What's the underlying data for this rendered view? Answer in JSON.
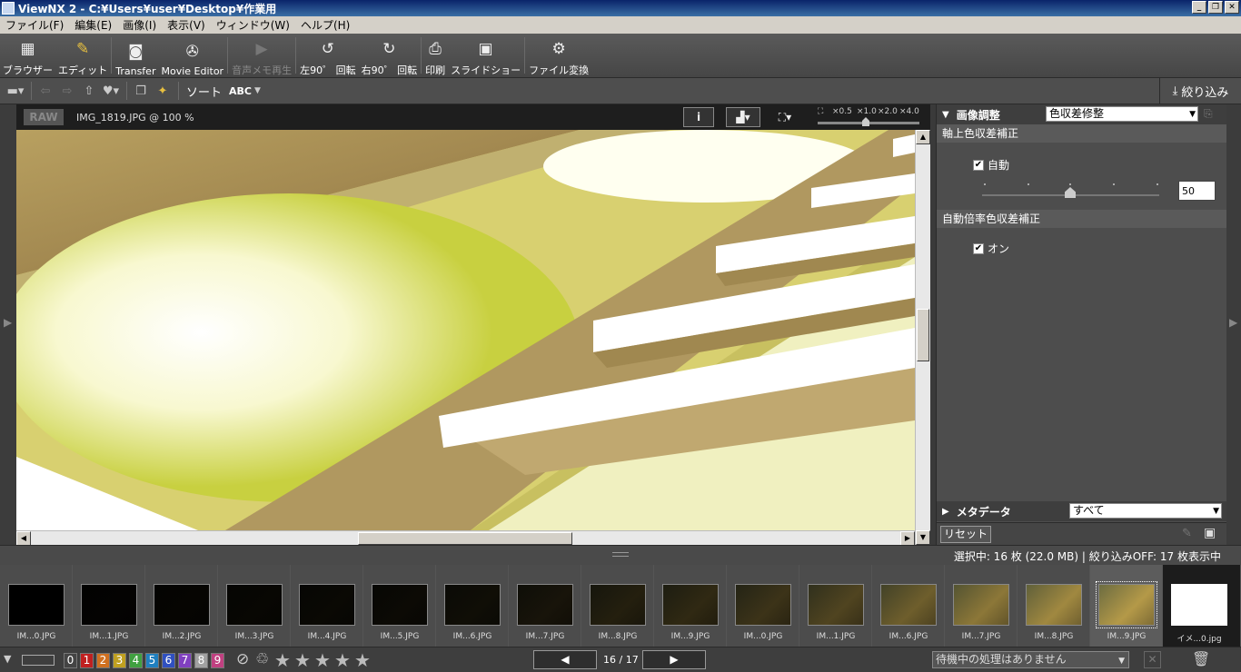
{
  "window": {
    "title": "ViewNX 2 - C:¥Users¥user¥Desktop¥作業用"
  },
  "menu": [
    "ファイル(F)",
    "編集(E)",
    "画像(I)",
    "表示(V)",
    "ウィンドウ(W)",
    "ヘルプ(H)"
  ],
  "toolbar": {
    "browser": "ブラウザー",
    "edit": "エディット",
    "transfer": "Transfer",
    "movie_editor": "Movie Editor",
    "voice_memo": "音声メモ再生",
    "rotate_left": "左90゜ 回転",
    "rotate_right": "右90゜ 回転",
    "print": "印刷",
    "slideshow": "スライドショー",
    "convert": "ファイル変換"
  },
  "toolbar2": {
    "sort_label": "ソート",
    "sort_value": "ABC",
    "filter_label": "絞り込み"
  },
  "viewer": {
    "raw_badge": "RAW",
    "filename": "IMG_1819.JPG @ 100 %",
    "zoom_levels": [
      "×0.5",
      "×1.0",
      "×2.0",
      "×4.0"
    ],
    "zoom_level": 1.0
  },
  "panel": {
    "title": "画像調整",
    "adjust_select": "色収差修整",
    "section1": "軸上色収差補正",
    "auto_label": "自動",
    "auto_checked": true,
    "slider_value": "50",
    "section2": "自動倍率色収差補正",
    "on_label": "オン",
    "on_checked": true,
    "metadata_title": "メタデータ",
    "metadata_select": "すべて",
    "reset": "リセット"
  },
  "status": "選択中: 16 枚 (22.0 MB) | 絞り込みOFF: 17 枚表示中",
  "thumbnails": [
    {
      "name": "IM...0.JPG",
      "bright": 0.0
    },
    {
      "name": "IM...1.JPG",
      "bright": 0.02
    },
    {
      "name": "IM...2.JPG",
      "bright": 0.03
    },
    {
      "name": "IM...3.JPG",
      "bright": 0.04
    },
    {
      "name": "IM...4.JPG",
      "bright": 0.05
    },
    {
      "name": "IM...5.JPG",
      "bright": 0.06
    },
    {
      "name": "IM...6.JPG",
      "bright": 0.08
    },
    {
      "name": "IM...7.JPG",
      "bright": 0.12
    },
    {
      "name": "IM...8.JPG",
      "bright": 0.18
    },
    {
      "name": "IM...9.JPG",
      "bright": 0.24
    },
    {
      "name": "IM...0.JPG",
      "bright": 0.3
    },
    {
      "name": "IM...1.JPG",
      "bright": 0.4
    },
    {
      "name": "IM...6.JPG",
      "bright": 0.55
    },
    {
      "name": "IM...7.JPG",
      "bright": 0.7
    },
    {
      "name": "IM...8.JPG",
      "bright": 0.8
    },
    {
      "name": "IM...9.JPG",
      "bright": 0.9
    },
    {
      "name": "イメ...0.jpg",
      "bright": 1.0
    }
  ],
  "selected_index": 15,
  "bottom": {
    "labels": [
      "0",
      "1",
      "2",
      "3",
      "4",
      "5",
      "6",
      "7",
      "8",
      "9"
    ],
    "label_colors": [
      "#888888",
      "#c02020",
      "#d07020",
      "#c0a020",
      "#40a040",
      "#2080c0",
      "#3050c0",
      "#8040c0",
      "#a0a0a0",
      "#c04080"
    ],
    "page": "16 / 17",
    "process": "待機中の処理はありません"
  }
}
